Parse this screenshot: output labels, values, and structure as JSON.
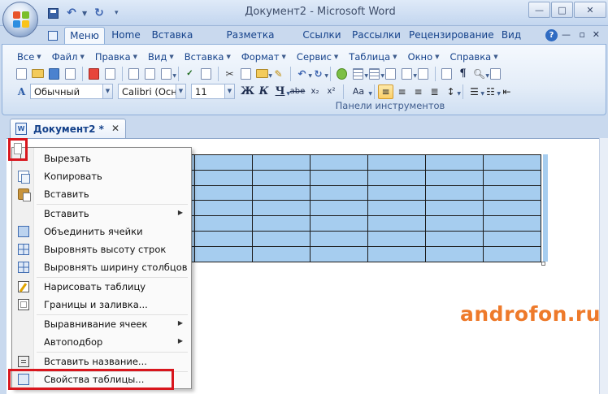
{
  "window": {
    "title": "Документ2 - Microsoft Word",
    "controls": [
      "—",
      "□",
      "✕"
    ]
  },
  "ribbon_tabs": [
    "Меню",
    "Home",
    "Вставка",
    "Разметка страницы",
    "Ссылки",
    "Рассылки",
    "Рецензирование",
    "Вид"
  ],
  "menu_bar": [
    "Все",
    "Файл",
    "Правка",
    "Вид",
    "Вставка",
    "Формат",
    "Сервис",
    "Таблица",
    "Окно",
    "Справка"
  ],
  "format_bar": {
    "style": "Обычный",
    "font": "Calibri (Осно",
    "size": "11",
    "bold": "Ж",
    "italic": "К",
    "underline": "Ч",
    "strike": "abe",
    "subscript": "x₂",
    "superscript": "x²",
    "change_case": "Aa",
    "group_label": "Панели инструментов"
  },
  "document_tab": {
    "title": "Документ2",
    "modified": "*",
    "close": "✕"
  },
  "table": {
    "rows": 7,
    "cols": 7,
    "cell_color": "#a6cdef"
  },
  "context_menu": [
    {
      "label": "Вырезать",
      "icon": "scissors-icon"
    },
    {
      "label": "Копировать",
      "icon": "copy-icon"
    },
    {
      "label": "Вставить",
      "icon": "paste-icon"
    },
    {
      "label": "Вставить",
      "icon": "",
      "submenu": true
    },
    {
      "label": "Объединить ячейки",
      "icon": "merge-cells-icon"
    },
    {
      "label": "Выровнять высоту строк",
      "icon": "distribute-rows-icon"
    },
    {
      "label": "Выровнять ширину столбцов",
      "icon": "distribute-columns-icon"
    },
    {
      "label": "Нарисовать таблицу",
      "icon": "draw-table-icon"
    },
    {
      "label": "Границы и заливка...",
      "icon": "borders-shading-icon"
    },
    {
      "label": "Выравнивание ячеек",
      "icon": "",
      "submenu": true
    },
    {
      "label": "Автоподбор",
      "icon": "",
      "submenu": true
    },
    {
      "label": "Вставить название...",
      "icon": "insert-caption-icon"
    },
    {
      "label": "Свойства таблицы...",
      "icon": "table-properties-icon"
    }
  ],
  "watermark": "androfon.ru",
  "colors": {
    "highlight_red": "#d8161d",
    "watermark_orange": "#ee7a2b",
    "ribbon_text": "#15428b"
  }
}
